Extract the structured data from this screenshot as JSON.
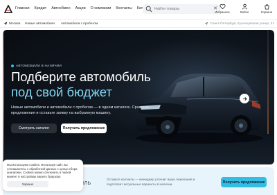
{
  "header": {
    "nav": [
      "Главная",
      "Кредит",
      "Автообмен",
      "Акции",
      "О компании",
      "Контакты",
      "Каталог"
    ],
    "search": {
      "placeholder": "Найти товары"
    },
    "actions": [
      {
        "label": "Избранное",
        "icon": "heart-icon"
      },
      {
        "label": "Войти",
        "icon": "user-icon"
      },
      {
        "label": "Корзина",
        "icon": "cart-icon"
      }
    ]
  },
  "subbar": {
    "city": "Москва",
    "links": [
      "Новые автомобили",
      "Автомобили с пробегом"
    ],
    "address": "Санкт-Петербург, Кузнецовская улица, 31"
  },
  "hero": {
    "badge": "АВТОМОБИЛИ В НАЛИЧИИ",
    "title_line1": "Подберите автомобиль",
    "title_line2": "под свой бюджет",
    "description": "Новые автомобили и автомобили с пробегом — в одном каталоге. Сравните предложения и оставьте заявку на выбранную машину.",
    "primary_button": "Смотреть каталог",
    "secondary_button": "Получить предложение",
    "accent_color": "#7fd6f0"
  },
  "strip": {
    "heading": "ИЛЬ",
    "info": "Оставьте контакты — менеджер уточнит ваши пожелания и подготовит актуальные варианты в наличии.",
    "cta": "Получить предложение",
    "cta_color": "#34bde3"
  },
  "cookie": {
    "text": "Мы используем cookies. Используя сайт, вы соглашаетесь с обработкой данных с целью сбора аналитики. Cookies можно отключить в любой момент в настройках вашего браузера",
    "ok": "Хорошо"
  }
}
